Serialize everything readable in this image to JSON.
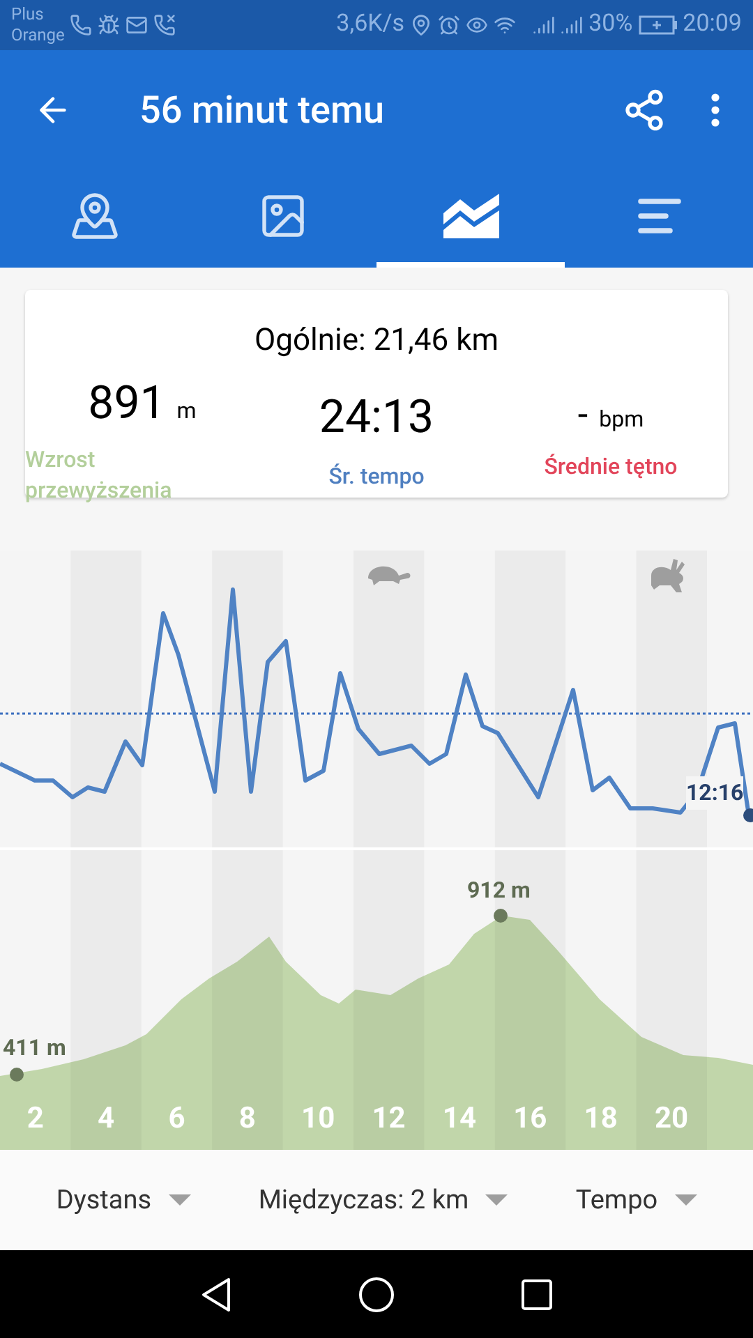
{
  "status_bar": {
    "carrier_lines": [
      "Plus",
      "Orange"
    ],
    "speed": "3,6K/s",
    "battery": "30%",
    "time": "20:09"
  },
  "app_bar": {
    "title": "56 minut temu"
  },
  "tabs": [
    {
      "kind": "map",
      "selected": false
    },
    {
      "kind": "photos",
      "selected": false
    },
    {
      "kind": "chart",
      "selected": true
    },
    {
      "kind": "splits",
      "selected": false
    }
  ],
  "summary": {
    "total": "Ogólnie: 21,46 km",
    "stats": [
      {
        "value": "891",
        "unit": "m",
        "label": "Wzrost przewyższenia",
        "color": "#b3cf9b"
      },
      {
        "value": "24:13",
        "label": "Śr. tempo",
        "color": "#4f7fc0"
      },
      {
        "value": "-",
        "unit": "bpm",
        "label": "Średnie tętno",
        "color": "#e2455a"
      }
    ]
  },
  "pace_chart": {
    "current_label": "12:16"
  },
  "elevation_chart": {
    "min_label": "411 m",
    "max_label": "912 m",
    "x_labels": [
      "2",
      "4",
      "6",
      "8",
      "10",
      "12",
      "14",
      "16",
      "18",
      "20"
    ]
  },
  "selectors": [
    {
      "label": "Dystans"
    },
    {
      "label": "Międzyczas: 2 km"
    },
    {
      "label": "Tempo"
    }
  ]
}
